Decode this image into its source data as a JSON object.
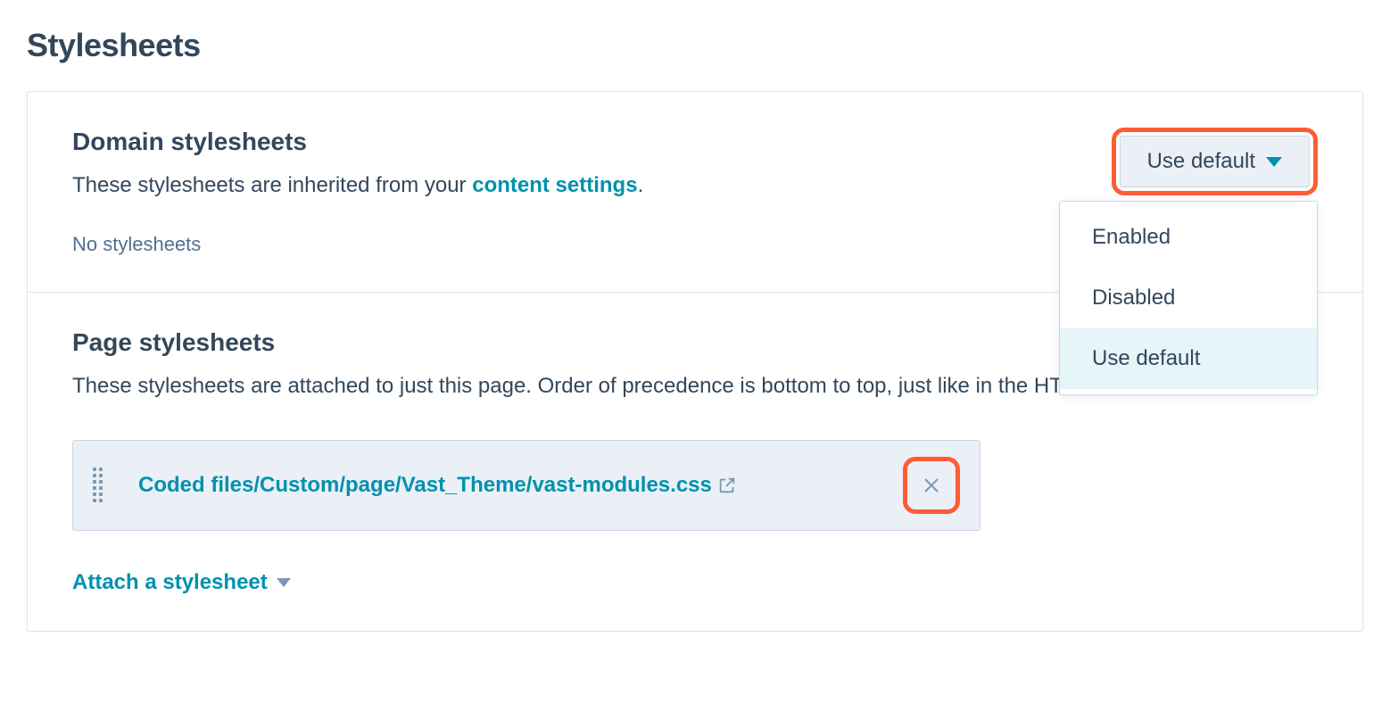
{
  "page_title": "Stylesheets",
  "domain": {
    "title": "Domain stylesheets",
    "desc_prefix": "These stylesheets are inherited from your ",
    "desc_link": "content settings",
    "desc_suffix": ".",
    "empty": "No stylesheets",
    "dropdown": {
      "label": "Use default",
      "options": [
        "Enabled",
        "Disabled",
        "Use default"
      ],
      "selected": "Use default"
    }
  },
  "page": {
    "title": "Page stylesheets",
    "desc": "These stylesheets are attached to just this page. Order of precedence is bottom to top, just like in the HTML.",
    "items": [
      {
        "path": "Coded files/Custom/page/Vast_Theme/vast-modules.css"
      }
    ],
    "attach_label": "Attach a stylesheet"
  }
}
